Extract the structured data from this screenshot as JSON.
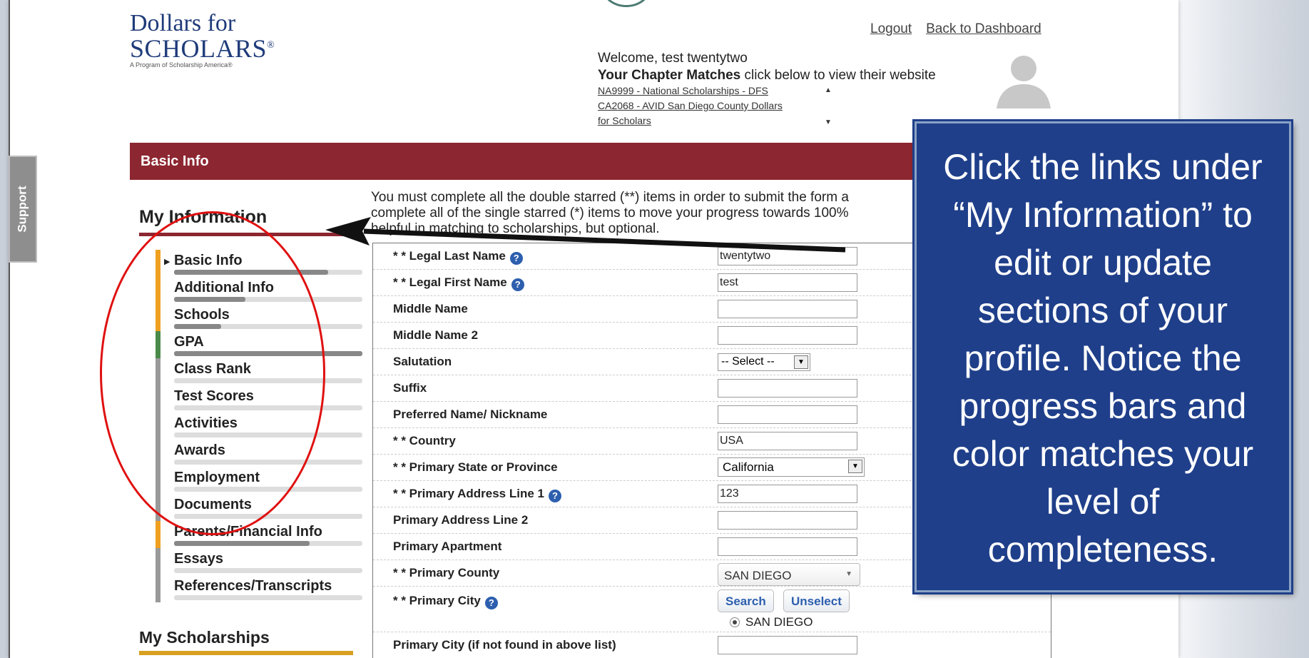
{
  "brand": {
    "line1": "Dollars for",
    "line2": "SCHOLARS",
    "mark": "®",
    "subtitle": "A Program of Scholarship America®"
  },
  "support_tab": "Support",
  "header": {
    "logout": "Logout",
    "back_to_dashboard": "Back to Dashboard",
    "welcome": "Welcome, test twentytwo",
    "matches_bold": "Your Chapter Matches",
    "matches_rest": " click below to view their website",
    "matches": [
      "NA9999 - National Scholarships - DFS",
      "CA2068 - AVID San Diego County Dollars",
      "for Scholars"
    ]
  },
  "section_bar": "Basic Info",
  "sidebar": {
    "title": "My Information",
    "items": [
      {
        "label": "Basic Info",
        "progress": 0.82,
        "stripe": "#f0a020",
        "current": true
      },
      {
        "label": "Additional Info",
        "progress": 0.38,
        "stripe": "#f0a020"
      },
      {
        "label": "Schools",
        "progress": 0.25,
        "stripe": "#f0a020"
      },
      {
        "label": "GPA",
        "progress": 1.0,
        "stripe": "#4a8a4a"
      },
      {
        "label": "Class Rank",
        "progress": 0.0,
        "stripe": "#999999"
      },
      {
        "label": "Test Scores",
        "progress": 0.0,
        "stripe": "#999999"
      },
      {
        "label": "Activities",
        "progress": 0.0,
        "stripe": "#999999"
      },
      {
        "label": "Awards",
        "progress": 0.0,
        "stripe": "#999999"
      },
      {
        "label": "Employment",
        "progress": 0.0,
        "stripe": "#999999"
      },
      {
        "label": "Documents",
        "progress": 0.0,
        "stripe": "#999999"
      },
      {
        "label": "Parents/Financial Info",
        "progress": 0.72,
        "stripe": "#f0a020"
      },
      {
        "label": "Essays",
        "progress": 0.0,
        "stripe": "#999999"
      },
      {
        "label": "References/Transcripts",
        "progress": 0.0,
        "stripe": "#999999"
      }
    ],
    "title2": "My Scholarships"
  },
  "intro": {
    "line1": "You must complete all the double starred (**) items in order to submit the form a",
    "line2": "complete all of the single starred (*) items to move your progress towards 100%",
    "line3": "helpful in matching to scholarships, but optional."
  },
  "form": {
    "rows": [
      {
        "label": "* * Legal Last Name",
        "help": true,
        "value": "twentytwo",
        "type": "text"
      },
      {
        "label": "* * Legal First Name",
        "help": true,
        "value": "test",
        "type": "text"
      },
      {
        "label": "Middle Name",
        "value": "",
        "type": "text"
      },
      {
        "label": "Middle Name 2",
        "value": "",
        "type": "text"
      },
      {
        "label": "Salutation",
        "value": "-- Select --",
        "type": "select-sm"
      },
      {
        "label": "Suffix",
        "value": "",
        "type": "text"
      },
      {
        "label": "Preferred Name/ Nickname",
        "value": "",
        "type": "text"
      },
      {
        "label": "* * Country",
        "value": "USA",
        "type": "text"
      },
      {
        "label": "* * Primary State or Province",
        "value": "California",
        "type": "select-lg"
      },
      {
        "label": "* * Primary Address Line 1",
        "help": true,
        "value": "123",
        "type": "text"
      },
      {
        "label": "Primary Address Line 2",
        "value": "",
        "type": "text"
      },
      {
        "label": "Primary Apartment",
        "value": "",
        "type": "text"
      },
      {
        "label": "* * Primary County",
        "value": "SAN DIEGO",
        "type": "county"
      },
      {
        "label": "* * Primary City",
        "help": true,
        "type": "city"
      },
      {
        "label": "Primary City (if not found in above list)",
        "value": "",
        "type": "text"
      }
    ],
    "search_label": "Search",
    "unselect_label": "Unselect",
    "city_option": "SAN DIEGO"
  },
  "callout": {
    "text": "Click the links under “My Information” to edit or update sections of your profile. Notice the progress bars and color matches your level of completeness."
  },
  "colors": {
    "brand_navy": "#1f3b7a",
    "section_red": "#8c2630",
    "callout_blue": "#1f3f8a",
    "annotation_red": "#e01010",
    "in_progress": "#f0a020",
    "complete": "#4a8a4a",
    "not_started": "#999999"
  },
  "icons": [
    "help-icon",
    "avatar-icon",
    "arrow-annotation",
    "dropdown-caret-icon"
  ]
}
